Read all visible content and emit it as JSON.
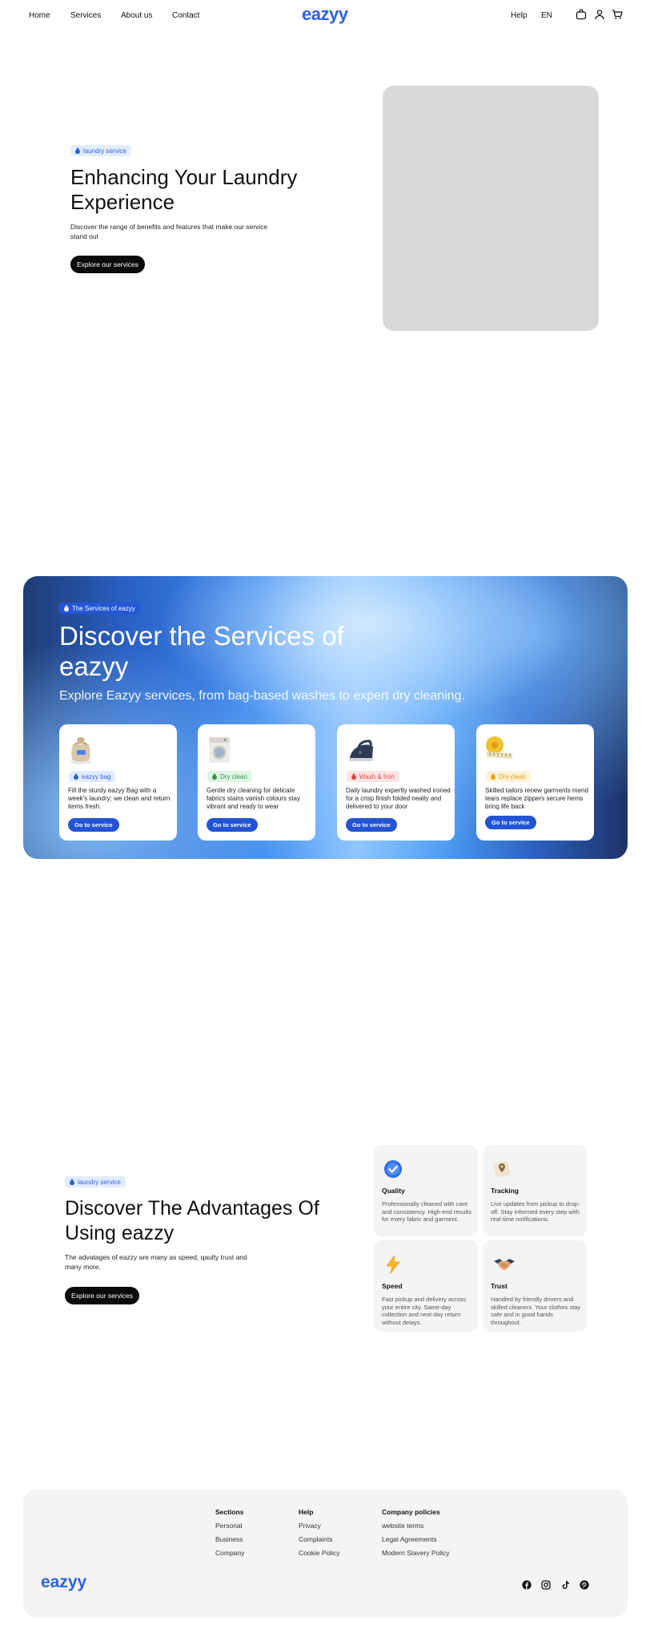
{
  "nav": {
    "links": [
      "Home",
      "Services",
      "About us",
      "Contact"
    ],
    "logo": "eazyy",
    "help": "Help",
    "language": "EN",
    "icons": [
      "bag-icon",
      "user-icon",
      "cart-icon"
    ]
  },
  "hero": {
    "tag": "laundry service",
    "title": "Enhancing Your Laundry Experience",
    "description": "Discover the range of benefits and features that make our service stand out",
    "cta": "Explore our services"
  },
  "services": {
    "tag": "The Services of eazyy",
    "title": "Discover the Services of eazyy",
    "subtitle": "Explore Eazyy services, from bag-based washes to expert dry cleaning.",
    "cards": [
      {
        "tag": "eazyy bag",
        "description": "Fill the sturdy eazyy Bag with a week's laundry; we clean and return items fresh.",
        "button": "Go to service",
        "icon": "laundry-bag-icon",
        "tag_color": "#2c62e2",
        "tag_bg": "#e3ecfd"
      },
      {
        "tag": "Dry clean",
        "description": "Gentle dry cleaning for delicate fabrics stains vanish colours stay vibrant and ready to wear",
        "button": "Go to service",
        "icon": "washing-machine-icon",
        "tag_color": "#2f9a4f",
        "tag_bg": "#dff5e4"
      },
      {
        "tag": "Wash & Iron",
        "description": "Daily laundry expertly washed ironed for a crisp finish folded neatly and delivered to your door",
        "button": "Go to service",
        "icon": "iron-icon",
        "tag_color": "#d94848",
        "tag_bg": "#fde3e3"
      },
      {
        "tag": "Dry clean",
        "description": "Skilled tailors renew garments mend tears replace zippers secure hems bring life back",
        "button": "Go to service",
        "icon": "measuring-tape-icon",
        "tag_color": "#e2a318",
        "tag_bg": "#fdf2d8"
      }
    ]
  },
  "advantages": {
    "tag": "laundry service",
    "title": "Discover The Advantages Of Using eazzy",
    "description": "The advatages of eazzy are many as speed, qaulty trust and many more.",
    "cta": "Explore our services",
    "features": [
      {
        "name": "Quality",
        "description": "Professionally cleaned with care and consistency. High-end results for every fabric and garment.",
        "icon": "check-badge-icon"
      },
      {
        "name": "Tracking",
        "description": "Live updates from pickup to drop-off. Stay informed every step with real-time notifications.",
        "icon": "map-pin-icon"
      },
      {
        "name": "Speed",
        "description": "Fast pickup and delivery across your entire city. Same-day collection and next-day return without delays.",
        "icon": "lightning-icon"
      },
      {
        "name": "Trust",
        "description": "Handled by friendly drivers and skilled cleaners. Your clothes stay safe and in good hands throughout.",
        "icon": "handshake-icon"
      }
    ]
  },
  "footer": {
    "logo": "eazyy",
    "columns": [
      {
        "title": "Sections",
        "links": [
          "Personal",
          "Business",
          "Company"
        ]
      },
      {
        "title": "Help",
        "links": [
          "Privacy",
          "Complaints",
          "Cookie Policy"
        ]
      },
      {
        "title": "Company policies",
        "links": [
          "website terms",
          "Legal Agreements",
          "Modern Slavery Policy"
        ]
      }
    ],
    "social": [
      "facebook-icon",
      "instagram-icon",
      "tiktok-icon",
      "pinterest-icon"
    ]
  },
  "colors": {
    "brand": "#2c62e2",
    "button_dark": "#0b0b0b",
    "button_blue": "#2254d4",
    "placeholder_gray": "#d9d9d9",
    "panel_gray": "#f4f4f4"
  }
}
